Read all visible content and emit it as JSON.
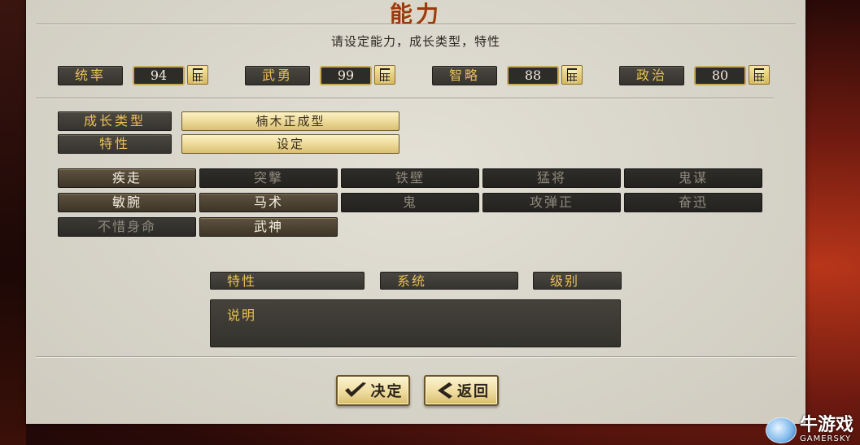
{
  "dialog": {
    "title": "能力",
    "subtitle": "请设定能力，成长类型，特性"
  },
  "stats": [
    {
      "label": "统率",
      "value": "94"
    },
    {
      "label": "武勇",
      "value": "99"
    },
    {
      "label": "智略",
      "value": "88"
    },
    {
      "label": "政治",
      "value": "80"
    }
  ],
  "growth": {
    "label": "成长类型",
    "value": "楠木正成型"
  },
  "trait": {
    "label": "特性",
    "value": "设定"
  },
  "skills": [
    {
      "name": "疾走",
      "state": "on"
    },
    {
      "name": "突撃",
      "state": "off"
    },
    {
      "name": "铁壁",
      "state": "off"
    },
    {
      "name": "猛将",
      "state": "off"
    },
    {
      "name": "鬼谋",
      "state": "off"
    },
    {
      "name": "敏腕",
      "state": "on"
    },
    {
      "name": "马术",
      "state": "on"
    },
    {
      "name": "鬼",
      "state": "off"
    },
    {
      "name": "攻弹正",
      "state": "off"
    },
    {
      "name": "奋迅",
      "state": "off"
    },
    {
      "name": "不惜身命",
      "state": "dim"
    },
    {
      "name": "武神",
      "state": "on"
    }
  ],
  "info_headers": {
    "trait": "特性",
    "system": "系统",
    "rank": "级别"
  },
  "description": {
    "label": "说明"
  },
  "buttons": {
    "confirm": "决定",
    "back": "返回"
  },
  "watermark": {
    "text": "牛游戏",
    "sub": "GAMERSKY"
  },
  "colors": {
    "label_text": "#e8c057",
    "panel_bg": "#d9d6cc",
    "title": "#9a3a12"
  }
}
